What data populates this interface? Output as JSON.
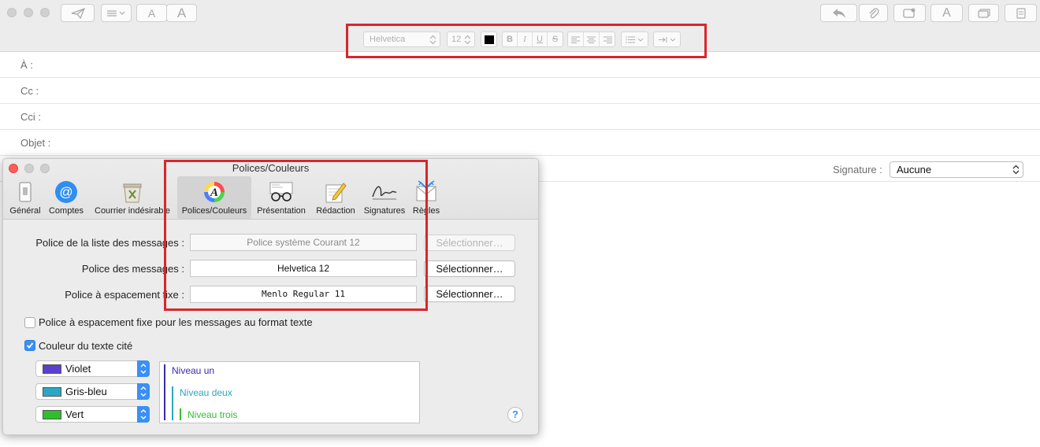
{
  "format_bar": {
    "font_name": "Helvetica",
    "font_size": "12",
    "bold": "B",
    "italic": "I",
    "underline": "U",
    "strike": "S"
  },
  "toolbar": {
    "font_smaller": "A",
    "font_larger": "A",
    "format_text": "A"
  },
  "fields": {
    "to": "À :",
    "cc": "Cc :",
    "bcc": "Cci :",
    "subject": "Objet :",
    "signature_label": "Signature :",
    "signature_value": "Aucune"
  },
  "prefs": {
    "title": "Polices/Couleurs",
    "tabs": [
      {
        "label": "Général",
        "icon": "general-switch-icon"
      },
      {
        "label": "Comptes",
        "icon": "at-sign-icon"
      },
      {
        "label": "Courrier indésirable",
        "icon": "junk-mail-trash-icon"
      },
      {
        "label": "Polices/Couleurs",
        "icon": "fonts-colors-icon"
      },
      {
        "label": "Présentation",
        "icon": "glasses-icon"
      },
      {
        "label": "Rédaction",
        "icon": "pencil-icon"
      },
      {
        "label": "Signatures",
        "icon": "signature-icon"
      },
      {
        "label": "Règles",
        "icon": "rules-envelope-icon"
      }
    ],
    "message_list_font_label": "Police de la liste des messages :",
    "message_list_font_value": "Police système Courant 12",
    "message_font_label": "Police des messages :",
    "message_font_value": "Helvetica 12",
    "fixed_font_label": "Police à espacement fixe :",
    "fixed_font_value": "Menlo Regular 11",
    "select_button": "Sélectionner…",
    "fixed_plain_text_label": "Police à espacement fixe pour les messages au format texte",
    "fixed_plain_text_checked": false,
    "quoted_color_label": "Couleur du texte cité",
    "quoted_color_checked": true,
    "colors": [
      {
        "name": "Violet",
        "hex": "#5a3fd1"
      },
      {
        "name": "Gris-bleu",
        "hex": "#2ba6c6"
      },
      {
        "name": "Vert",
        "hex": "#2fbf2c"
      }
    ],
    "levels": [
      "Niveau un",
      "Niveau deux",
      "Niveau trois"
    ],
    "help": "?"
  },
  "accent_color": "#3b8ff5",
  "highlight_color": "#d9262a"
}
